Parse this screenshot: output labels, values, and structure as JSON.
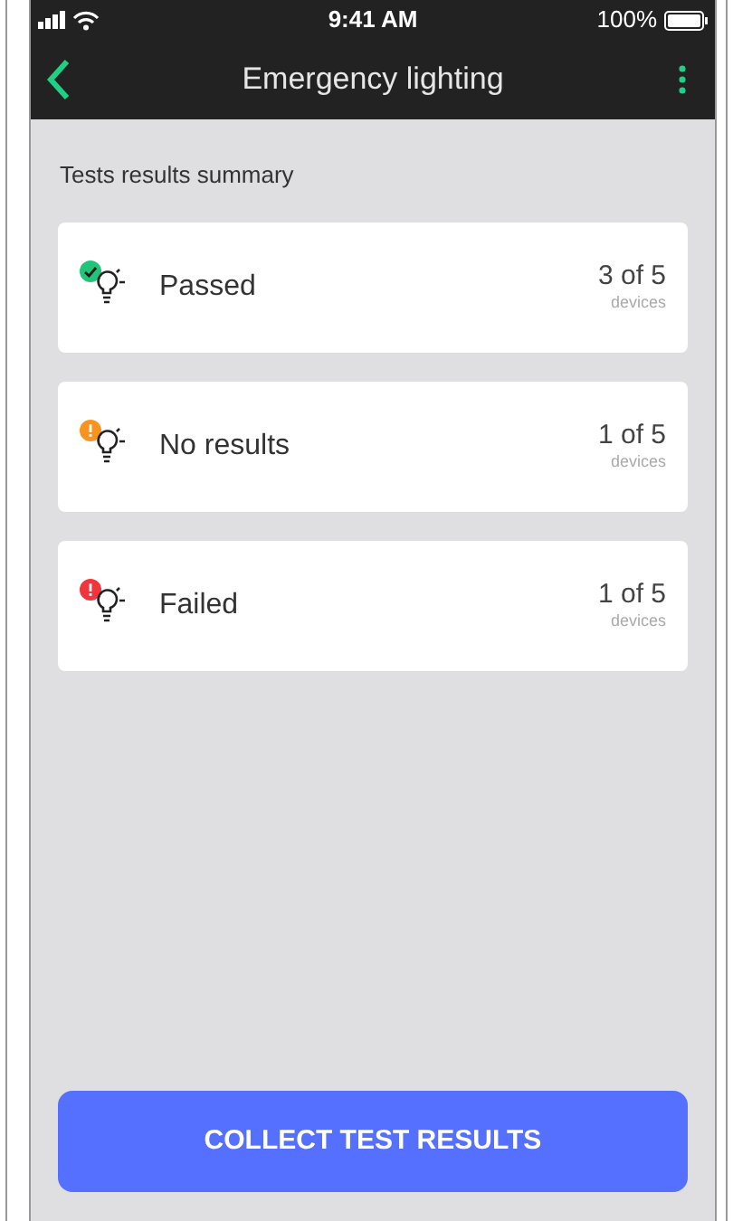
{
  "status_bar": {
    "time": "9:41 AM",
    "battery": "100%"
  },
  "header": {
    "title": "Emergency lighting"
  },
  "section_title": "Tests results summary",
  "results": [
    {
      "label": "Passed",
      "kind": "passed",
      "color": "#22c47a",
      "count": "3 of 5",
      "unit": "devices"
    },
    {
      "label": "No results",
      "kind": "warning",
      "color": "#f7931e",
      "count": "1 of 5",
      "unit": "devices"
    },
    {
      "label": "Failed",
      "kind": "failed",
      "color": "#f0353d",
      "count": "1 of 5",
      "unit": "devices"
    }
  ],
  "button": "COLLECT TEST RESULTS"
}
